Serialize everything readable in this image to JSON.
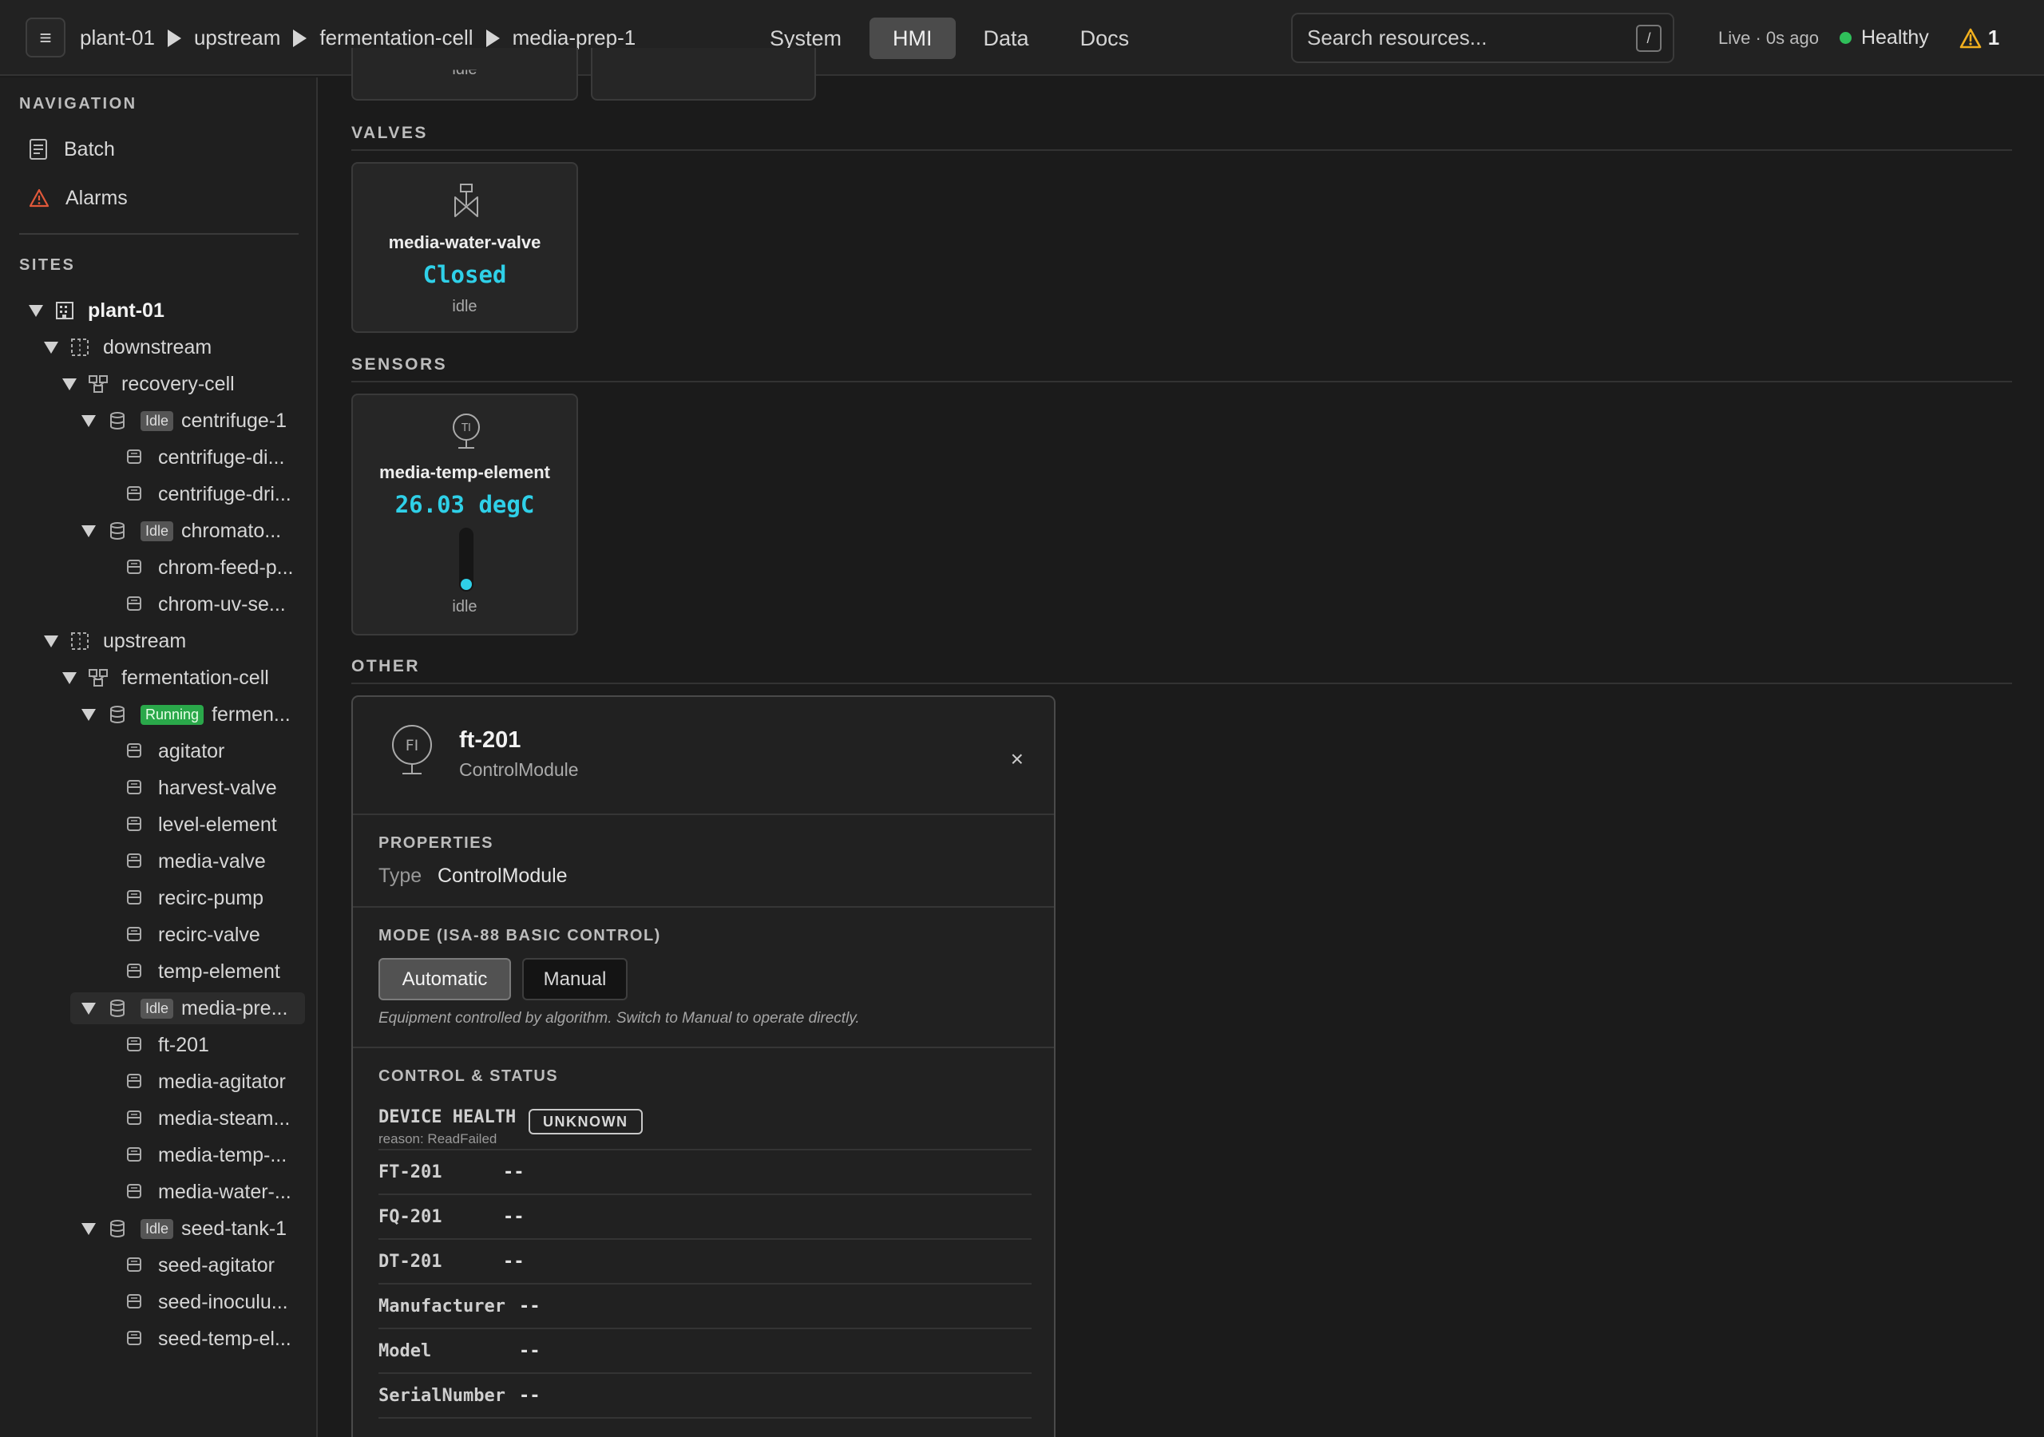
{
  "topbar": {
    "menu_glyph": "≡",
    "breadcrumb": [
      "plant-01",
      "upstream",
      "fermentation-cell",
      "media-prep-1"
    ],
    "tabs": [
      "System",
      "HMI",
      "Data",
      "Docs"
    ],
    "active_tab": "HMI",
    "search_placeholder": "Search resources...",
    "search_shortcut": "/",
    "live_text": "Live · 0s ago",
    "health": "Healthy",
    "alarm_count": "1",
    "colors": {
      "healthy": "#2fbf5a",
      "warning": "#f2b01e",
      "accent": "#2fd0e8"
    }
  },
  "sidebar": {
    "navigation_heading": "NAVIGATION",
    "nav_items": [
      {
        "label": "Batch",
        "icon": "clipboard-icon"
      },
      {
        "label": "Alarms",
        "icon": "warning-icon"
      }
    ],
    "sites_heading": "SITES",
    "tree": [
      {
        "label": "plant-01",
        "icon": "building-icon"
      },
      {
        "label": "downstream",
        "icon": "area-icon"
      },
      {
        "label": "recovery-cell",
        "icon": "cell-icon"
      },
      {
        "label": "centrifuge-1",
        "icon": "unit-icon",
        "badge": "Idle"
      },
      {
        "label": "centrifuge-di...",
        "icon": "module-icon"
      },
      {
        "label": "centrifuge-dri...",
        "icon": "module-icon"
      },
      {
        "label": "chromato...",
        "icon": "unit-icon",
        "badge": "Idle"
      },
      {
        "label": "chrom-feed-p...",
        "icon": "module-icon"
      },
      {
        "label": "chrom-uv-se...",
        "icon": "module-icon"
      },
      {
        "label": "upstream",
        "icon": "area-icon"
      },
      {
        "label": "fermentation-cell",
        "icon": "cell-icon"
      },
      {
        "label": "fermen...",
        "icon": "unit-icon",
        "badge": "Running"
      },
      {
        "label": "agitator",
        "icon": "module-icon"
      },
      {
        "label": "harvest-valve",
        "icon": "module-icon"
      },
      {
        "label": "level-element",
        "icon": "module-icon"
      },
      {
        "label": "media-valve",
        "icon": "module-icon"
      },
      {
        "label": "recirc-pump",
        "icon": "module-icon"
      },
      {
        "label": "recirc-valve",
        "icon": "module-icon"
      },
      {
        "label": "temp-element",
        "icon": "module-icon"
      },
      {
        "label": "media-pre...",
        "icon": "unit-icon",
        "badge": "Idle"
      },
      {
        "label": "ft-201",
        "icon": "module-icon"
      },
      {
        "label": "media-agitator",
        "icon": "module-icon"
      },
      {
        "label": "media-steam...",
        "icon": "module-icon"
      },
      {
        "label": "media-temp-...",
        "icon": "module-icon"
      },
      {
        "label": "media-water-...",
        "icon": "module-icon"
      },
      {
        "label": "seed-tank-1",
        "icon": "unit-icon",
        "badge": "Idle"
      },
      {
        "label": "seed-agitator",
        "icon": "module-icon"
      },
      {
        "label": "seed-inoculu...",
        "icon": "module-icon"
      },
      {
        "label": "seed-temp-el...",
        "icon": "module-icon"
      }
    ]
  },
  "content": {
    "top_card_state": "idle",
    "sections": {
      "valves": "VALVES",
      "sensors": "SENSORS",
      "other": "OTHER"
    },
    "valve_card": {
      "name": "media-water-valve",
      "value": "Closed",
      "state": "idle",
      "icon": "valve-icon"
    },
    "sensor_card": {
      "name": "media-temp-element",
      "value": "26.03 degC",
      "state": "idle",
      "icon": "temperature-sensor-icon",
      "icon_text": "TI",
      "level": 0.05
    }
  },
  "detail": {
    "icon_text": "FI",
    "title": "ft-201",
    "subtitle": "ControlModule",
    "close_glyph": "×",
    "properties_heading": "PROPERTIES",
    "type_label": "Type",
    "type_value": "ControlModule",
    "mode_heading": "MODE (ISA-88 BASIC CONTROL)",
    "mode_options": [
      "Automatic",
      "Manual"
    ],
    "mode_selected": "Automatic",
    "mode_hint": "Equipment controlled by algorithm. Switch to Manual to operate directly.",
    "control_heading": "CONTROL & STATUS",
    "device_health_label": "DEVICE HEALTH",
    "device_health_badge": "UNKNOWN",
    "device_health_reason": "reason: ReadFailed",
    "rows": [
      {
        "key": "FT-201",
        "value": "--"
      },
      {
        "key": "FQ-201",
        "value": "--"
      },
      {
        "key": "DT-201",
        "value": "--"
      },
      {
        "key": "Manufacturer",
        "value": "--"
      },
      {
        "key": "Model",
        "value": "--"
      },
      {
        "key": "SerialNumber",
        "value": "--"
      }
    ]
  }
}
